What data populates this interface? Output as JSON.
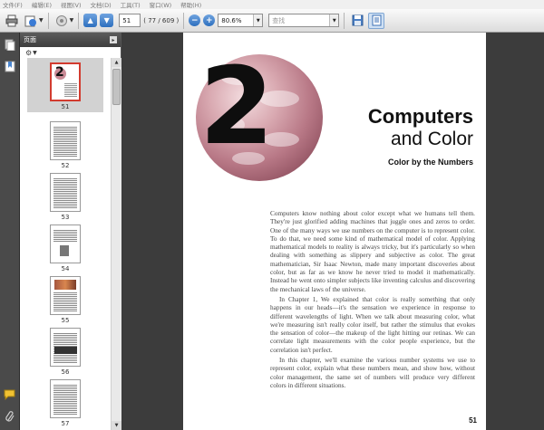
{
  "menu": [
    "文件(F)",
    "编辑(E)",
    "视图(V)",
    "文档(D)",
    "工具(T)",
    "窗口(W)",
    "帮助(H)"
  ],
  "toolbar": {
    "icons": [
      "print-icon",
      "share-icon",
      "export-icon",
      "prev-page-icon",
      "next-page-icon",
      "zoom-out-icon",
      "zoom-in-icon",
      "save-icon",
      "fit-page-icon"
    ],
    "current_page": "51",
    "page_count": "( 77 / 609 )",
    "zoom": "80.6%",
    "search_placeholder": "查找"
  },
  "sidebar": {
    "title": "页面",
    "thumbnails": [
      {
        "label": "51",
        "selected": true
      },
      {
        "label": "52",
        "selected": false
      },
      {
        "label": "53",
        "selected": false
      },
      {
        "label": "54",
        "selected": false
      },
      {
        "label": "55",
        "selected": false
      },
      {
        "label": "56",
        "selected": false
      },
      {
        "label": "57",
        "selected": false
      }
    ]
  },
  "document": {
    "chapter_number": "2",
    "title_line1": "Computers",
    "title_line2": "and Color",
    "subtitle": "Color by the Numbers",
    "paragraph1": "Computers know nothing about color except what we humans tell them. They're just glorified adding machines that juggle ones and zeros to order. One of the many ways we use numbers on the computer is to represent color. To do that, we need some kind of mathematical model of color. Applying mathematical models to reality is always tricky, but it's particularly so when dealing with something as slippery and subjective as color. The great mathematician, Sir Isaac Newton, made many important discoveries about color, but as far as we know he never tried to model it mathematically. Instead he went onto simpler subjects like inventing calculus and discovering the mechanical laws of the universe.",
    "paragraph2": "In Chapter 1, We explained that color is really something that only happens in our heads—it's the sensation we experience in response to different wavelengths of light. When we talk about measuring color, what we're measuring isn't really color itself, but rather the stimulus that evokes the sensation of color—the makeup of the light hitting our retinas. We can correlate light measurements with the color people experience, but the correlation isn't perfect.",
    "paragraph3": "In this chapter, we'll examine the various number systems we use to represent color, explain what these numbers mean, and show how, without color management, the same set of numbers will produce very different colors in different situations.",
    "page_number": "51"
  },
  "colors": {
    "selection_border": "#d23b2f",
    "nav_button": "#2d6fbe"
  }
}
